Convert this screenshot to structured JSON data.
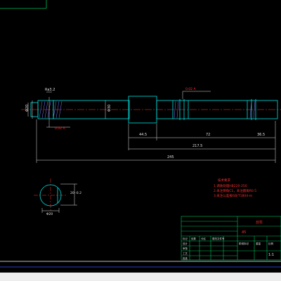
{
  "drawing": {
    "colors": {
      "background": "#000000",
      "outline": "#00e0e0",
      "dimension": "#e0e0e0",
      "center_line": "#ff3030",
      "hatch": "#7a7aff",
      "note_text": "#ff3030",
      "frame": "#ffffff",
      "title_block": "#00c060",
      "footer": "#ededed"
    },
    "dimensions": {
      "left_end": "Φ20",
      "body_dia": "Φ30",
      "length_a": "44.5",
      "length_b": "72",
      "length_c": "36.5",
      "total_inner": "217.5",
      "total_overall": "245"
    },
    "annotations": {
      "left_callout": "Ra3.2",
      "top_tolerance": "0.02 A",
      "keyway_note": "0.02 A"
    },
    "section_view": {
      "label_right": "20 -0.2",
      "label_bottom": "Φ20"
    },
    "notes": {
      "title": "技术要求",
      "lines": [
        "1.调质处理HB220-250",
        "2.未注倒角C1，未注圆角R0.5",
        "3.未注公差按GB/T1804-m"
      ]
    },
    "title_block": {
      "part_name": "丝杠",
      "material": "45",
      "scale": "1:1",
      "cells_left": [
        "设计",
        "审核",
        "工艺",
        "批准"
      ],
      "cells_mid": [
        "标记",
        "处数",
        "分区",
        "更改文件号"
      ],
      "cells_right": [
        "阶段标记",
        "重量",
        "比例"
      ]
    }
  }
}
